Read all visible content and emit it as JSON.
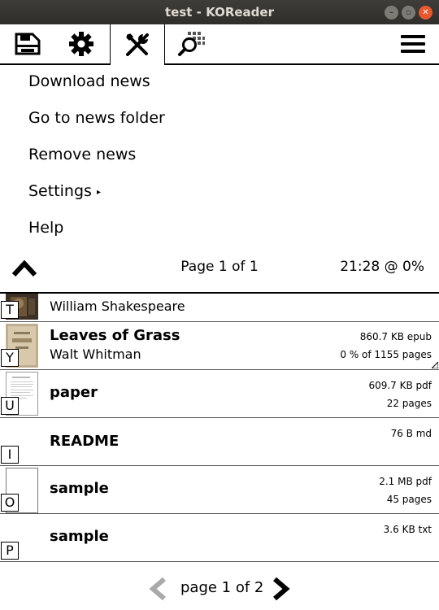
{
  "window": {
    "title": "test - KOReader",
    "buttons": [
      "minimize",
      "maximize",
      "close"
    ],
    "close_color": "#e8582e"
  },
  "tabs": [
    {
      "icon": "filemanager-icon",
      "active": false
    },
    {
      "icon": "gear-icon",
      "active": false
    },
    {
      "icon": "tools-icon",
      "active": true
    },
    {
      "icon": "search-icon",
      "active": false
    },
    {
      "icon": "hamburger-menu-icon",
      "active": false
    }
  ],
  "menu": {
    "items": [
      {
        "label": "Download news"
      },
      {
        "label": "Go to news folder"
      },
      {
        "label": "Remove news"
      },
      {
        "label": "Settings",
        "submenu_arrow": "▸"
      },
      {
        "label": "Help"
      }
    ],
    "page_label": "Page 1 of 1",
    "clock": "21:28 @ 0%"
  },
  "files": [
    {
      "hotkey": "T",
      "title": "",
      "author": "William Shakespeare",
      "size": "",
      "info": ""
    },
    {
      "hotkey": "Y",
      "title": "Leaves of Grass",
      "author": "Walt Whitman",
      "size": "860.7 KB  epub",
      "info": "0 % of 1155 pages"
    },
    {
      "hotkey": "U",
      "title": "paper",
      "author": "",
      "size": "609.7 KB  pdf",
      "info": "22 pages"
    },
    {
      "hotkey": "I",
      "title": "README",
      "author": "",
      "size": "76 B  md",
      "info": ""
    },
    {
      "hotkey": "O",
      "title": "sample",
      "author": "",
      "size": "2.1 MB  pdf",
      "info": "45 pages"
    },
    {
      "hotkey": "P",
      "title": "sample",
      "author": "",
      "size": "3.6 KB  txt",
      "info": ""
    }
  ],
  "pager": {
    "label": "page 1 of 2",
    "prev_enabled": false,
    "next_enabled": true
  }
}
